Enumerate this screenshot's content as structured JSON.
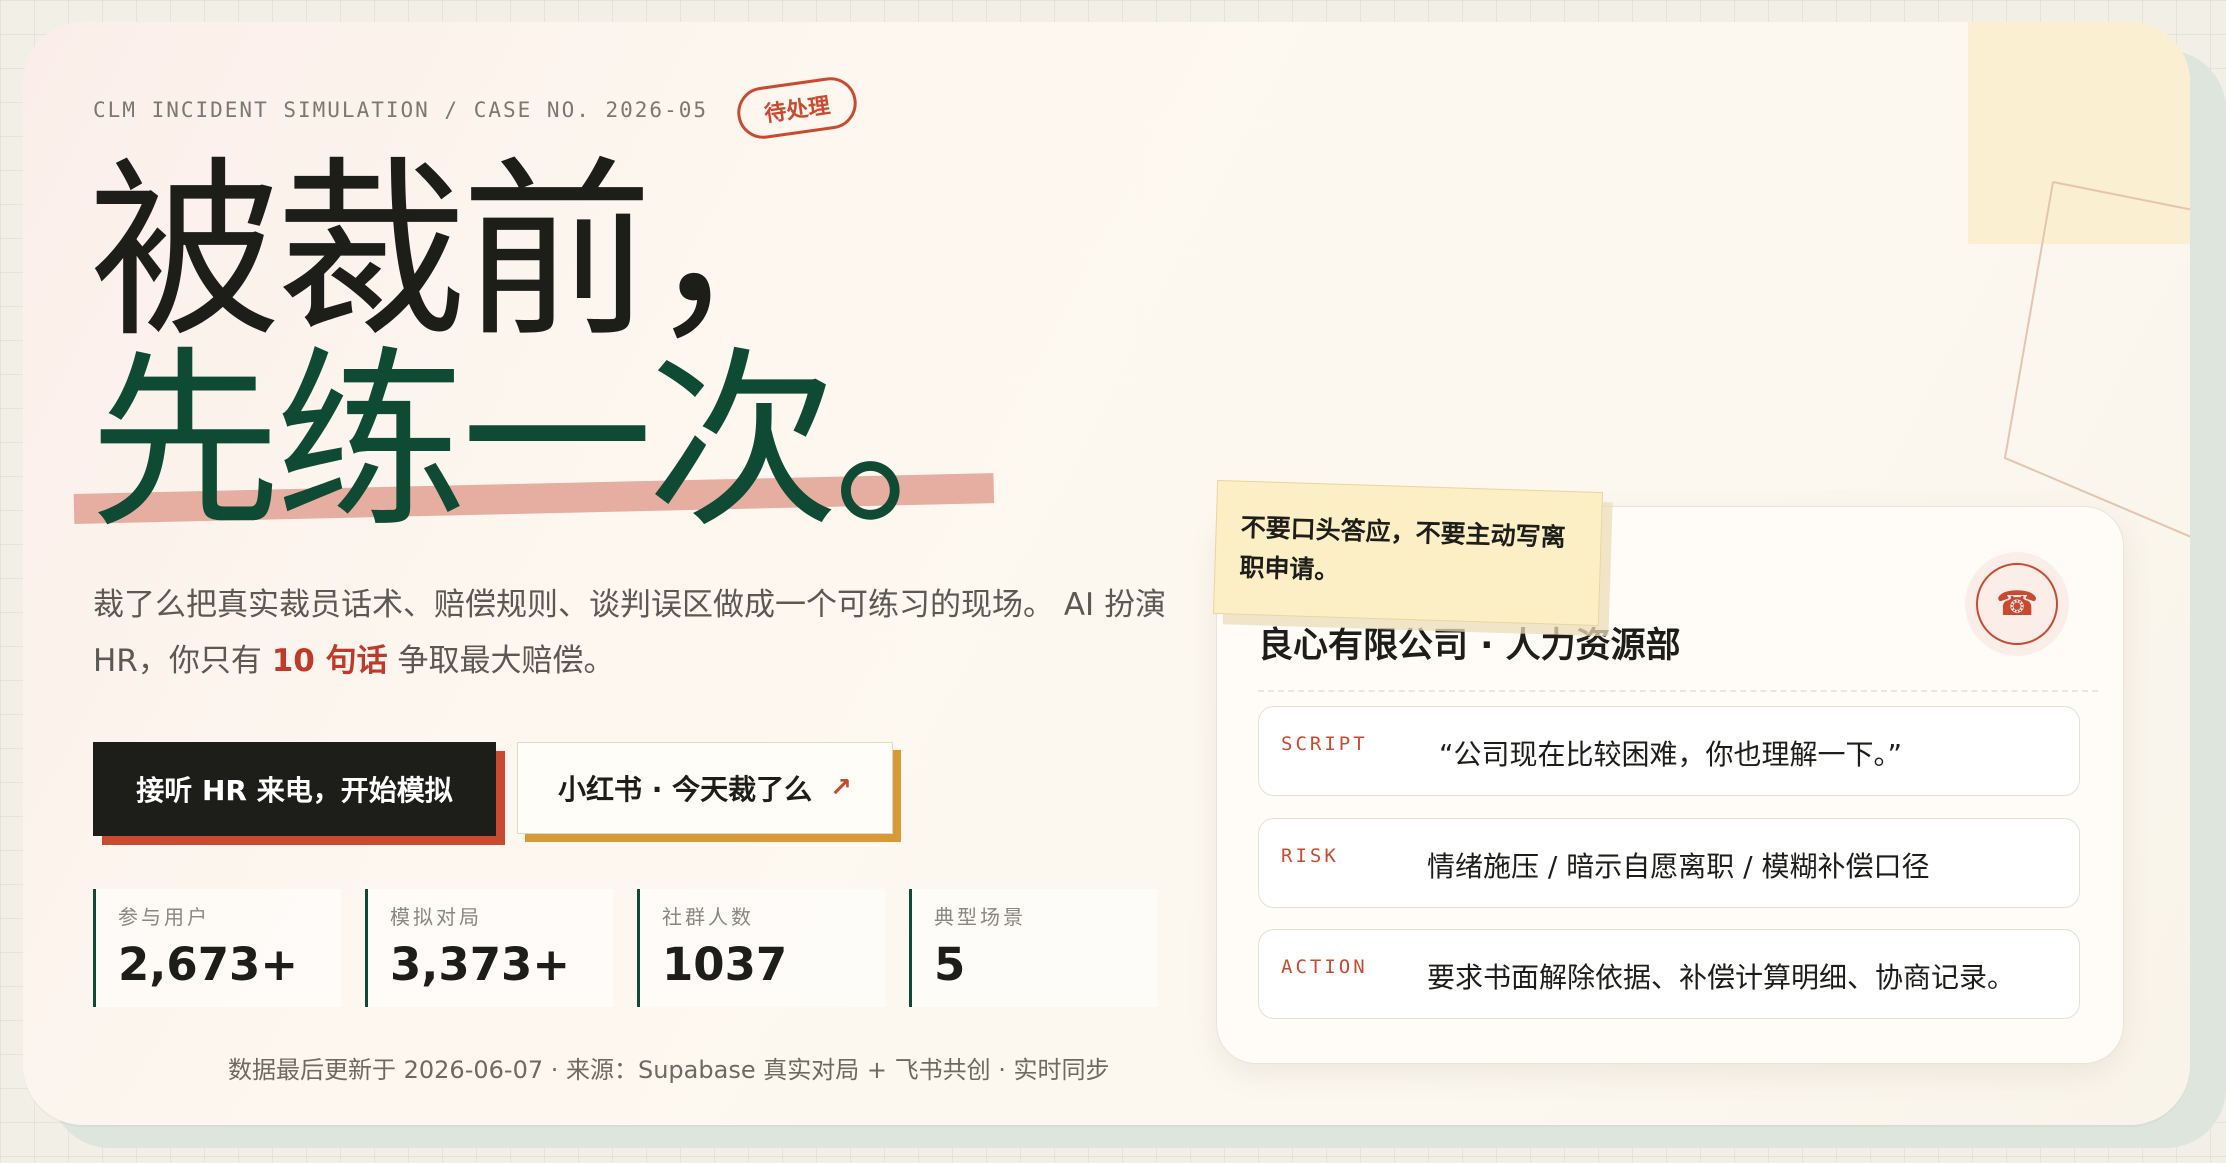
{
  "header": {
    "case_line": "CLM INCIDENT SIMULATION / CASE NO. 2026-05",
    "stamp": "待处理"
  },
  "hero": {
    "title_line1": "被裁前，",
    "title_line2": "先练一次。",
    "subtitle_part1": "裁了么把真实裁员话术、赔偿规则、谈判误区做成一个可练习的现场。 AI 扮演 HR，你只有 ",
    "subtitle_accent": "10 句话",
    "subtitle_part2": " 争取最大赔偿。"
  },
  "actions": {
    "primary_label": "接听 HR 来电，开始模拟",
    "secondary_label": "小红书 · 今天裁了么",
    "secondary_icon": "arrow-up-right-icon"
  },
  "stats": [
    {
      "label": "参与用户",
      "value": "2,673+"
    },
    {
      "label": "模拟对局",
      "value": "3,373+"
    },
    {
      "label": "社群人数",
      "value": "1037"
    },
    {
      "label": "典型场景",
      "value": "5"
    }
  ],
  "footnote": "数据最后更新于 2026-06-07 · 来源：Supabase 真实对局 + 飞书共创 · 实时同步",
  "panel": {
    "sticky_note": "不要口头答应，不要主动写离职申请。",
    "company": "良心有限公司 · 人力资源部",
    "phone_icon": "phone-icon",
    "rows": [
      {
        "tag": "SCRIPT",
        "text": "“公司现在比较困难，你也理解一下。”"
      },
      {
        "tag": "RISK",
        "text": "情绪施压 / 暗示自愿离职 / 模糊补偿口径"
      },
      {
        "tag": "ACTION",
        "text": "要求书面解除依据、补偿计算明细、协商记录。"
      }
    ]
  },
  "colors": {
    "ink": "#1d1d1a",
    "green": "#0f4a35",
    "red": "#c84b31",
    "amber": "#d89a36",
    "highlight": "#e6aea1",
    "sticky": "#fcefc6"
  }
}
